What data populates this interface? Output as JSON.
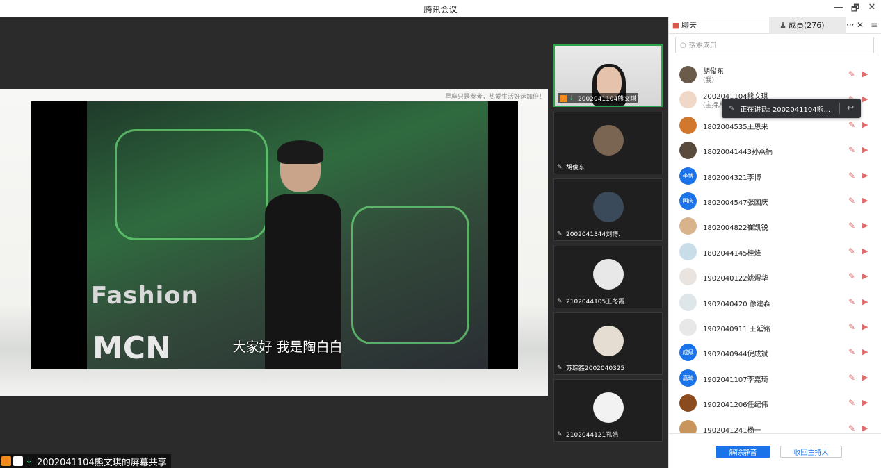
{
  "app": {
    "title": "腾讯会议",
    "window_controls": {
      "minimize": "—",
      "restore": "🗗",
      "close": "✕"
    }
  },
  "share": {
    "caption": "星座只是参考，热爱生活好运加倍！",
    "subtitle": "大家好 我是陶白白",
    "sign_top": "Fashion",
    "sign_bottom": "MCN",
    "status_label": "2002041104熊文琪的屏幕共享"
  },
  "gallery": {
    "tiles": [
      {
        "name": "2002041104熊文琪",
        "active": true
      },
      {
        "name": "胡俊东"
      },
      {
        "name": "2002041344刘博."
      },
      {
        "name": "2102044105王冬霞"
      },
      {
        "name": "苏琮鑫2002040325"
      },
      {
        "name": "2102044121孔浩"
      }
    ]
  },
  "panel": {
    "tabs": {
      "chat": "聊天",
      "members": "成员(276)"
    },
    "more": "···",
    "close": "✕",
    "menu": "≡",
    "search_placeholder": "搜索成员",
    "speaking_banner": "正在讲话: 2002041104熊...",
    "members": [
      {
        "name": "胡俊东",
        "sub": "(我)",
        "avatar_color": "#6b5b4b"
      },
      {
        "name": "2002041104熊文琪",
        "sub": "(主持人",
        "avatar_color": "#f0d8c8"
      },
      {
        "name": "1802004535王恩来",
        "avatar_color": "#d2782c"
      },
      {
        "name": "18020041443孙燕楠",
        "avatar_color": "#5a4a3c"
      },
      {
        "name": "1802004321李博",
        "avatar_text": "李博",
        "avatar_color": "#1a73e8"
      },
      {
        "name": "1802004547张国庆",
        "avatar_text": "国庆",
        "avatar_color": "#1a73e8"
      },
      {
        "name": "1802004822崔凯锐",
        "avatar_color": "#d9b38c"
      },
      {
        "name": "1802044145桂烽",
        "avatar_color": "#c9dde8"
      },
      {
        "name": "1902040122姚煜华",
        "avatar_color": "#e9e4df"
      },
      {
        "name": "1902040420 徐建森",
        "avatar_color": "#dfe6ea"
      },
      {
        "name": "1902040911 王延铭",
        "avatar_color": "#e8e8e8"
      },
      {
        "name": "1902040944倪成斌",
        "avatar_text": "成斌",
        "avatar_color": "#1a73e8"
      },
      {
        "name": "1902041107李嘉琦",
        "avatar_text": "嘉琦",
        "avatar_color": "#1a73e8"
      },
      {
        "name": "1902041206任纪伟",
        "avatar_color": "#8a4b1f"
      },
      {
        "name": "1902041241杨一",
        "avatar_color": "#c8955c"
      }
    ],
    "footer": {
      "unmute_all": "解除静音",
      "reclaim_host": "收回主持人"
    }
  }
}
